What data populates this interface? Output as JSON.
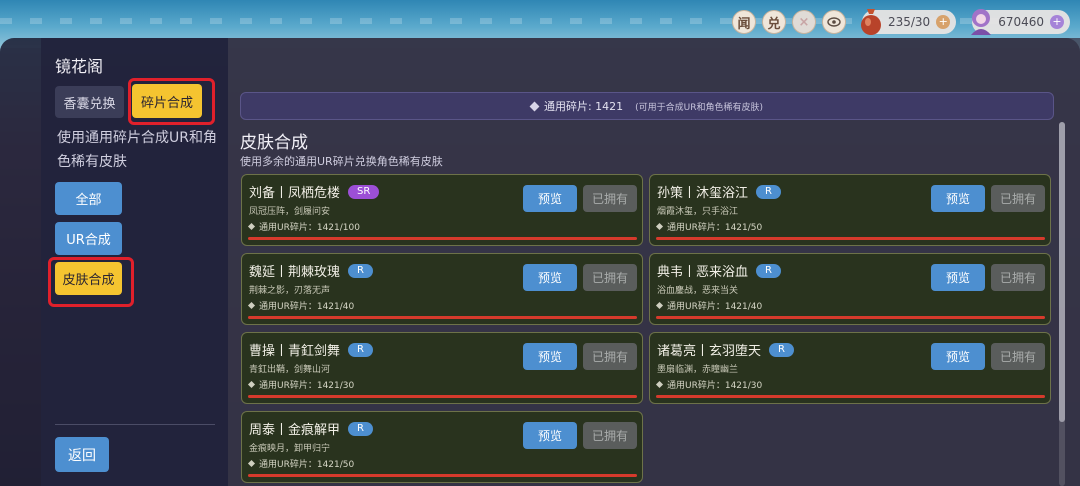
{
  "hud": {
    "btn_wen": "闻",
    "btn_dui": "兑",
    "btn_close": "×",
    "btn_eye_icon": "eye-icon",
    "bag_count": "235/30",
    "gem_count": "670460",
    "plus": "+"
  },
  "sidebar": {
    "title": "镜花阁",
    "tabs": [
      "香囊兑换",
      "碎片合成"
    ],
    "description": "使用通用碎片合成UR和角色稀有皮肤",
    "categories": [
      "全部",
      "UR合成",
      "皮肤合成"
    ],
    "back": "返回"
  },
  "banner": {
    "label": "通用碎片: 1421",
    "note": "(可用于合成UR和角色稀有皮肤)"
  },
  "section": {
    "title": "皮肤合成",
    "subtitle": "使用多余的通用UR碎片兑换角色稀有皮肤"
  },
  "buttons": {
    "preview": "预览",
    "owned": "已拥有"
  },
  "skins": [
    {
      "name": "刘备丨凤栖危楼",
      "rarity": "SR",
      "desc": "凤冠压阵，剑履问安",
      "cost": "通用UR碎片：1421/100",
      "progress": 1.0
    },
    {
      "name": "孙策丨沐玺浴江",
      "rarity": "R",
      "desc": "烟霞沐玺，只手浴江",
      "cost": "通用UR碎片：1421/50",
      "progress": 1.0
    },
    {
      "name": "魏延丨荆棘玫瑰",
      "rarity": "R",
      "desc": "荆棘之影，刃落无声",
      "cost": "通用UR碎片：1421/40",
      "progress": 1.0
    },
    {
      "name": "典韦丨恶来浴血",
      "rarity": "R",
      "desc": "浴血鏖战，恶来当关",
      "cost": "通用UR碎片：1421/40",
      "progress": 1.0
    },
    {
      "name": "曹操丨青釭剑舞",
      "rarity": "R",
      "desc": "青釭出鞘，剑舞山河",
      "cost": "通用UR碎片：1421/30",
      "progress": 1.0
    },
    {
      "name": "诸葛亮丨玄羽堕天",
      "rarity": "R",
      "desc": "墨扇临渊，赤瞳幽兰",
      "cost": "通用UR碎片：1421/30",
      "progress": 1.0
    },
    {
      "name": "周泰丨金痕解甲",
      "rarity": "R",
      "desc": "金痕映月，卸甲归宁",
      "cost": "通用UR碎片：1421/50",
      "progress": 1.0
    }
  ]
}
